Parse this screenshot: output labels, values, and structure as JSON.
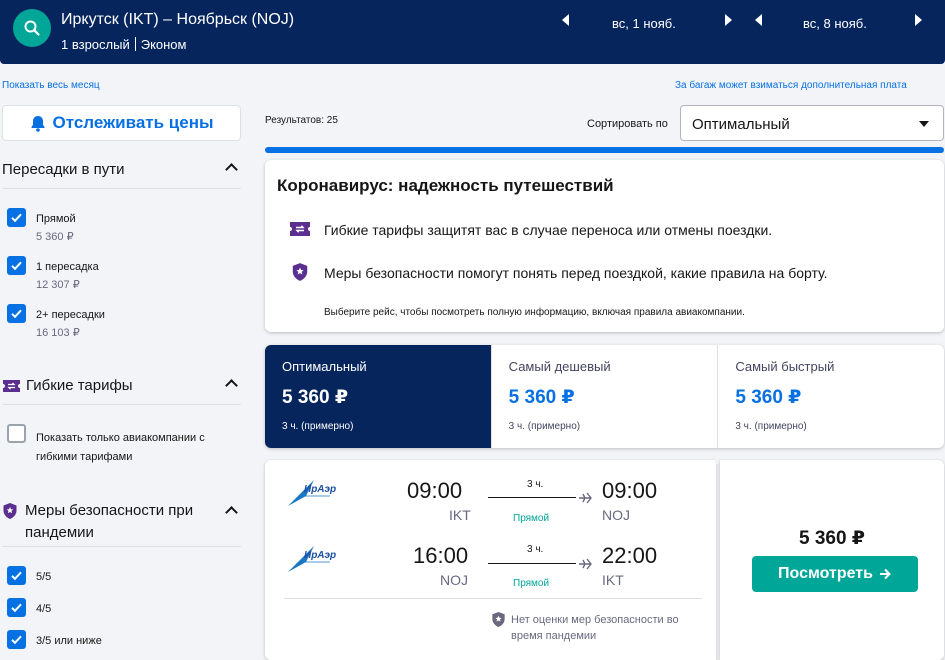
{
  "header": {
    "route": "Иркутск (IKT) – Ноябрьск (NOJ)",
    "passengers": "1 взрослый",
    "cabin": "Эконом",
    "depart_date": "вс, 1 нояб.",
    "return_date": "вс, 8 нояб."
  },
  "links": {
    "whole_month": "Показать весь месяц",
    "baggage_note": "За багаж может взиматься дополнительная плата"
  },
  "sidebar": {
    "track_prices": "Отслеживать цены",
    "stops": {
      "title": "Пересадки в пути",
      "options": [
        {
          "label": "Прямой",
          "price": "5 360 ₽",
          "checked": true
        },
        {
          "label": "1 пересадка",
          "price": "12 307 ₽",
          "checked": true
        },
        {
          "label": "2+ пересадки",
          "price": "16 103 ₽",
          "checked": true
        }
      ]
    },
    "flex": {
      "title": "Гибкие тарифы",
      "option": "Показать только авиакомпании с гибкими тарифами"
    },
    "safety": {
      "title": "Меры безопасности при пандемии",
      "options": [
        "5/5",
        "4/5",
        "3/5 или ниже"
      ]
    }
  },
  "results": {
    "count": "Результатов: 25",
    "sort_label": "Сортировать по",
    "sort_value": "Оптимальный"
  },
  "covid": {
    "title": "Коронавирус: надежность путешествий",
    "line1": "Гибкие тарифы защитят вас в случае переноса или отмены поездки.",
    "line2": "Меры безопасности помогут понять перед поездкой, какие правила на борту.",
    "note": "Выберите рейс, чтобы посмотреть полную информацию, включая правила авиакомпании."
  },
  "tabs": [
    {
      "name": "Оптимальный",
      "price": "5 360 ₽",
      "duration": "3 ч. (примерно)"
    },
    {
      "name": "Самый дешевый",
      "price": "5 360 ₽",
      "duration": "3 ч. (примерно)"
    },
    {
      "name": "Самый быстрый",
      "price": "5 360 ₽",
      "duration": "3 ч. (примерно)"
    }
  ],
  "flight": {
    "airline_logo_text": "ИрАэро",
    "outbound": {
      "dep_time": "09:00",
      "dep_code": "IKT",
      "duration": "3 ч.",
      "stops": "Прямой",
      "arr_time": "09:00",
      "arr_code": "NOJ"
    },
    "inbound": {
      "dep_time": "16:00",
      "dep_code": "NOJ",
      "duration": "3 ч.",
      "stops": "Прямой",
      "arr_time": "22:00",
      "arr_code": "IKT"
    },
    "safety_note": "Нет оценки мер безопасности во время пандемии",
    "price": "5 360 ₽",
    "view_button": "Посмотреть"
  },
  "colors": {
    "header_bg": "#06255d",
    "accent_blue": "#0770e3",
    "accent_green": "#00a698"
  }
}
